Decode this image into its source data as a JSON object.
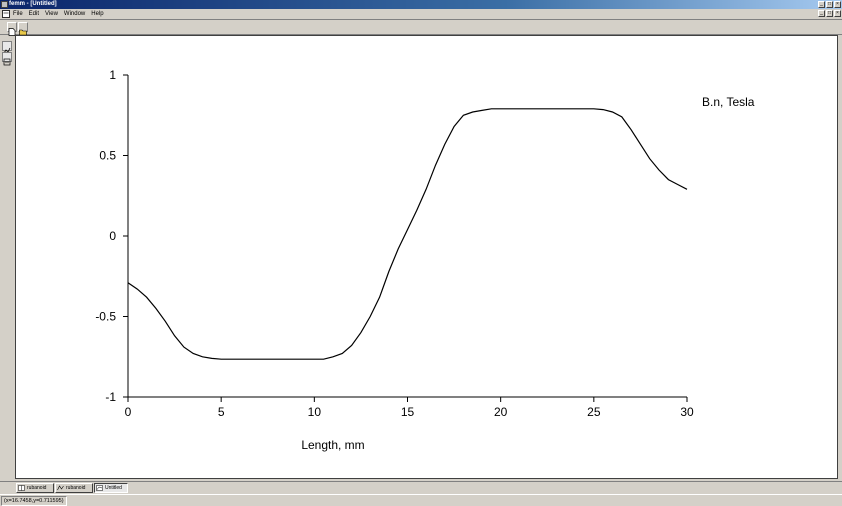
{
  "window": {
    "title": "femm - [Untitled]"
  },
  "menu": {
    "items": [
      "File",
      "Edit",
      "View",
      "Window",
      "Help"
    ]
  },
  "tabs": [
    {
      "label": "rubanoid",
      "active": false
    },
    {
      "label": "rubanoid",
      "active": false
    },
    {
      "label": "Untitled",
      "active": true
    }
  ],
  "status": {
    "coords": "(x=16.7458,y=0.711595)"
  },
  "chart_data": {
    "type": "line",
    "title": "",
    "annotation": "B.n, Tesla",
    "xlabel": "Length, mm",
    "ylabel": "",
    "xlim": [
      0,
      30
    ],
    "ylim": [
      -1,
      1
    ],
    "xticks": [
      0,
      5,
      10,
      15,
      20,
      25,
      30
    ],
    "yticks": [
      1,
      0.5,
      0,
      -0.5,
      -1
    ],
    "xtick_labels": [
      "0",
      "5",
      "10",
      "15",
      "20",
      "25",
      "30"
    ],
    "ytick_labels": [
      "1",
      "0.5",
      "0",
      "-0.5",
      "-1"
    ],
    "grid": false,
    "series": [
      {
        "x": [
          0,
          0.5,
          1.0,
          1.5,
          2.0,
          2.5,
          3.0,
          3.5,
          4.0,
          4.5,
          5.0,
          6,
          7,
          8,
          9,
          10,
          10.5,
          11,
          11.5,
          12,
          12.5,
          13,
          13.5,
          14,
          14.5,
          15,
          15.5,
          16,
          16.5,
          17,
          17.5,
          18,
          18.5,
          19,
          19.5,
          20,
          21,
          22,
          23,
          24,
          25,
          25.5,
          26,
          26.5,
          27,
          27.5,
          28,
          28.5,
          29,
          29.5,
          30
        ],
        "y": [
          -0.29,
          -0.33,
          -0.38,
          -0.45,
          -0.53,
          -0.62,
          -0.69,
          -0.73,
          -0.75,
          -0.76,
          -0.765,
          -0.765,
          -0.765,
          -0.765,
          -0.765,
          -0.765,
          -0.765,
          -0.75,
          -0.73,
          -0.68,
          -0.6,
          -0.5,
          -0.38,
          -0.22,
          -0.08,
          0.04,
          0.16,
          0.29,
          0.44,
          0.57,
          0.68,
          0.75,
          0.77,
          0.78,
          0.79,
          0.79,
          0.79,
          0.79,
          0.79,
          0.79,
          0.79,
          0.785,
          0.77,
          0.74,
          0.66,
          0.57,
          0.48,
          0.41,
          0.35,
          0.32,
          0.29
        ]
      }
    ]
  }
}
